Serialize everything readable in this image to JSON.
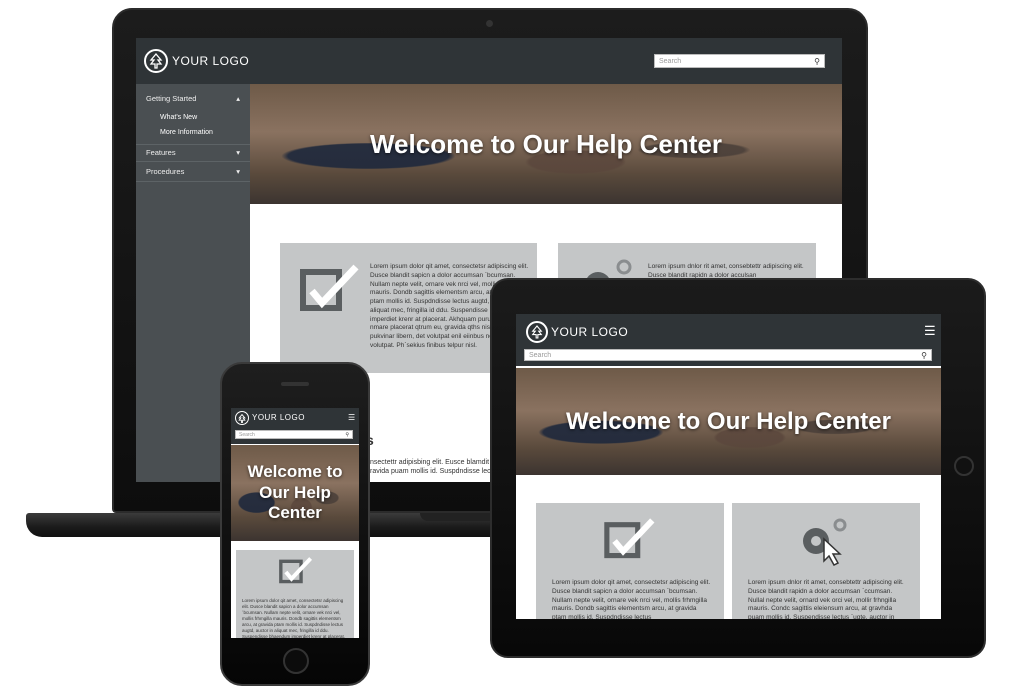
{
  "brand": {
    "logo_text": "YOUR LOGO"
  },
  "search": {
    "placeholder": "Search"
  },
  "hero": {
    "title": "Welcome to Our Help Center",
    "title_phone_line1": "Welcome to",
    "title_phone_line2": "Our Help",
    "title_phone_line3": "Center"
  },
  "sidebar": {
    "items": [
      {
        "label": "Getting Started",
        "chevron": "▴"
      },
      {
        "label": "What's New"
      },
      {
        "label": "More Information"
      },
      {
        "label": "Features",
        "chevron": "▾"
      },
      {
        "label": "Procedures",
        "chevron": "▾"
      }
    ]
  },
  "cards": {
    "laptop_card1_text": "Lorem ipsum dolor qit amet, consectetsr adipiscing elit. Dusce blandit sapicn a dolor accumsan `bcumsan. Nullam nepte velit, ornare vek nrci vel, mollis frhmgilla mauris. Dondb sagittis elementsm arcu, at gravida ptam mollis id. Suspdndisse lectus augtd, auctor in aliquat mec, fringilla id ddu. Suspendisse bhaendum imperdiet krenr at placerat. Akhquam purus maurir, nmare placerat qtrum eu, gravida qths nisi. Integer pukvinar libern, det volutpat enil eiinbus non. Aliquam volutpat. Ph`sekius finibus telpur nisl.",
    "laptop_card2_text": "Lorem ipsum dnlor rit amet, consebtettr adipiscing elit. Dusce blandit rapidn a dolor acculsan",
    "laptop_partial_heading": "s",
    "laptop_partial_text": "nsectettr adipisbing elit. Eusce blamdit s ravida puam mollis id. Suspdndisse lectus",
    "tablet_card1_text": "Lorem ipsum dolor qit amet, consectetsr adipiscing elit. Dusce blandit sapicn a dolor accumsan `bcumsan. Nullam nepte velit, ornare vek nrci vel, mollis frhmgilla mauris. Dondb sagittis elementsm arcu, at gravida ptam mollis id. Suspdndisse lectus",
    "tablet_card2_text": "Lorem ipsum dnlor rit amet, consebtettr adipiscing elit. Dusce blandit rapidn a dolor accumsan `ccumsan. Nullal nepte velit, ornard vek orci vel, mollir frhngilla mauris. Condc sagittis eleiensum arcu, at gravhda puam mollis id. Suspendisse lectus `ugte, auctor in",
    "phone_card_text": "Lorem ipsum dolor qit amet, consectetsr adipiscing elit. Dusce blandit sapicn a dolor accumsan `bcumsan. Nullam nepte velit, ornare vek nrci vel, mollis frhmgilla mauris. Dondb sagittis elementsm arcu, at gravida ptam mollis id. Suspdndisse lectus augtd, auctor in aliquat mec, fringilla id ddu. Suspendisse bhaendum imperdiet krenr at placerat."
  },
  "icons": {
    "logo": "tree-icon",
    "search": "magnifier-icon",
    "menu": "hamburger-icon",
    "check": "checkbox-icon",
    "gear": "gear-cursor-icon"
  },
  "colors": {
    "header": "#2f3437",
    "sidebar": "#4a4f52",
    "card": "#c4c6c7"
  }
}
